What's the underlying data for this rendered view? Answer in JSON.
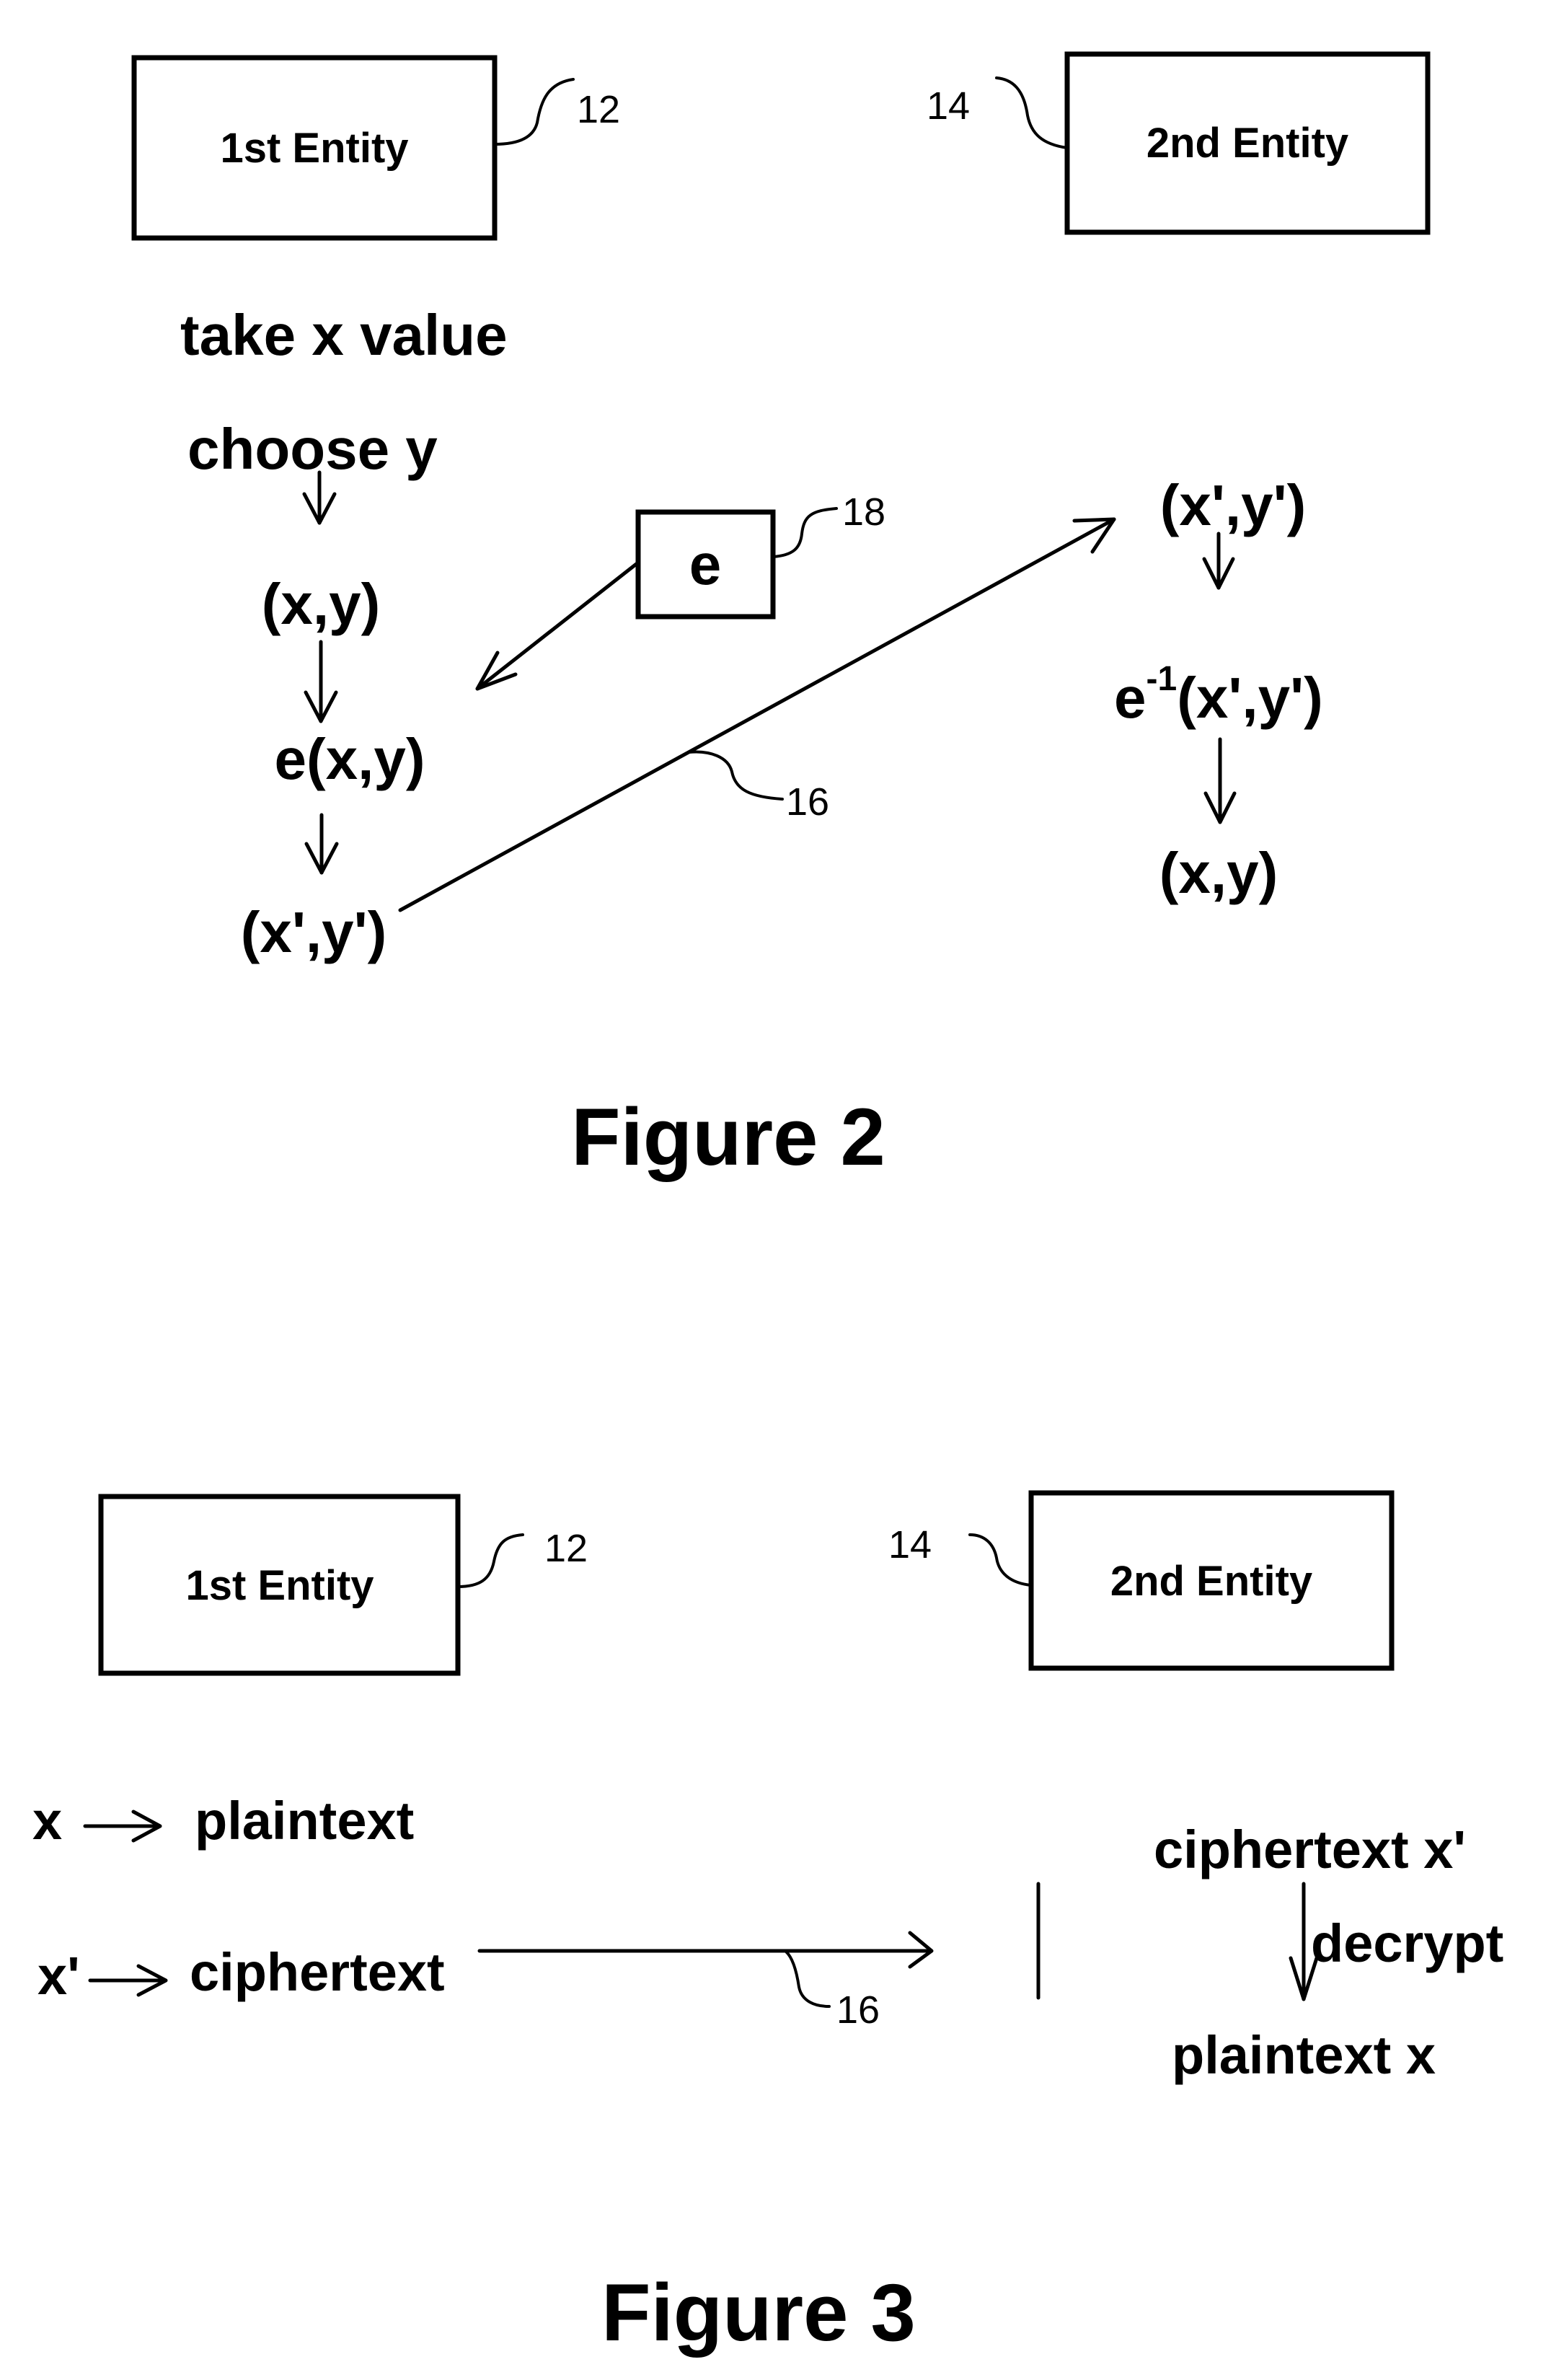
{
  "figure2": {
    "caption": "Figure 2",
    "first_entity": {
      "label": "1st Entity",
      "ref": "12"
    },
    "second_entity": {
      "label": "2nd Entity",
      "ref": "14"
    },
    "encryption_box": {
      "label": "e",
      "ref": "18"
    },
    "channel_ref": "16",
    "left_steps": [
      "take x value",
      "choose y",
      "(x,y)",
      "e(x,y)",
      "(x',y')"
    ],
    "right_steps": {
      "received": "(x',y')",
      "decrypt_base": "e",
      "decrypt_sup": "-1",
      "decrypt_args": "(x',y')",
      "result": "(x,y)"
    }
  },
  "figure3": {
    "caption": "Figure 3",
    "first_entity": {
      "label": "1st Entity",
      "ref": "12"
    },
    "second_entity": {
      "label": "2nd Entity",
      "ref": "14"
    },
    "channel_ref": "16",
    "mapping": [
      {
        "symbol": "x",
        "meaning": "plaintext"
      },
      {
        "symbol": "x'",
        "meaning": "ciphertext"
      }
    ],
    "right_steps": {
      "received": "ciphertext x'",
      "action": "decrypt",
      "result": "plaintext x"
    }
  }
}
